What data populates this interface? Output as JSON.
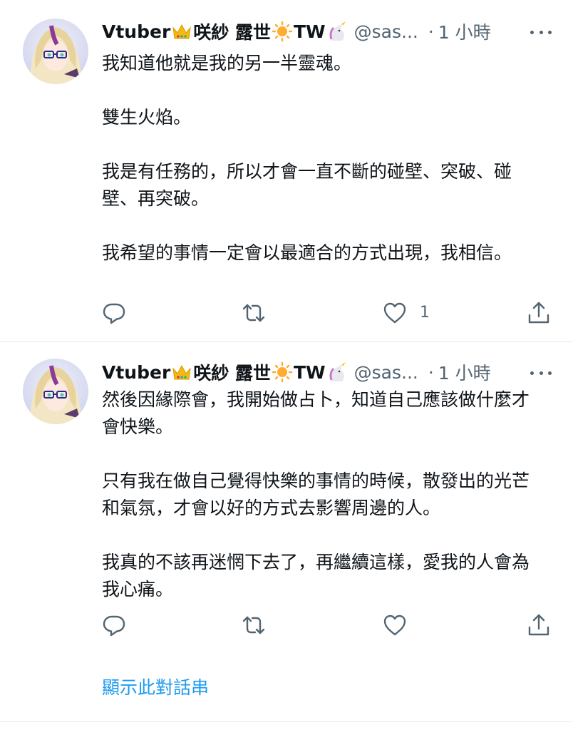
{
  "tweets": [
    {
      "author_name": "Vtuber",
      "author_name_suffix": "咲紗 露世",
      "author_tag": "TW",
      "handle": "@sas...",
      "separator": "·",
      "time": "1 小時",
      "paragraphs": [
        "我知道他就是我的另一半靈魂。",
        "雙生火焰。",
        "我是有任務的，所以才會一直不斷的碰壁、突破、碰壁、再突破。",
        "我希望的事情一定會以最適合的方式出現，我相信。"
      ],
      "like_count": "1"
    },
    {
      "author_name": "Vtuber",
      "author_name_suffix": "咲紗 露世",
      "author_tag": "TW",
      "handle": "@sas...",
      "separator": "·",
      "time": "1 小時",
      "paragraphs": [
        "然後因緣際會，我開始做占卜，知道自己應該做什麼才會快樂。",
        "只有我在做自己覺得快樂的事情的時候，散發出的光芒和氣氛，才會以好的方式去影響周邊的人。",
        "我真的不該再迷惘下去了，再繼續這樣，愛我的人會為我心痛。"
      ],
      "like_count": ""
    }
  ],
  "show_thread_label": "顯示此對話串",
  "colors": {
    "text": "#0f1419",
    "secondary": "#536471",
    "link": "#1d9bf0",
    "divider": "#e6ecf0"
  },
  "icons": {
    "crown": "crown-icon",
    "sun": "sun-icon",
    "unicorn": "unicorn-icon",
    "reply": "reply-icon",
    "retweet": "retweet-icon",
    "like": "heart-icon",
    "share": "share-icon",
    "more": "more-icon"
  }
}
